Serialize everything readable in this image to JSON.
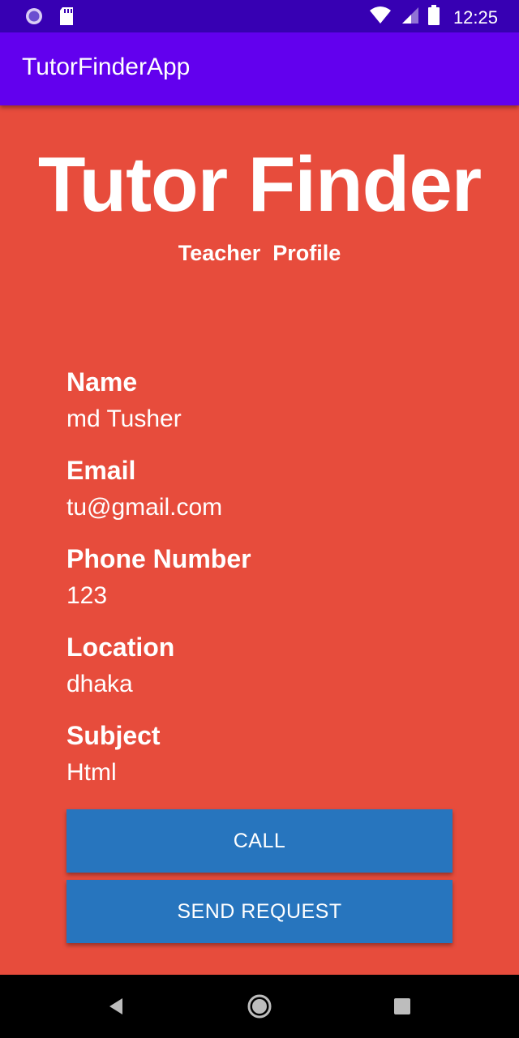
{
  "status_bar": {
    "time": "12:25",
    "icons": [
      "app-notification-icon",
      "sd-card-icon",
      "wifi-icon",
      "signal-icon",
      "battery-icon"
    ]
  },
  "app_bar": {
    "title": "TutorFinderApp"
  },
  "hero": {
    "title": "Tutor Finder",
    "subtitle": "Teacher  Profile"
  },
  "profile": {
    "name_label": "Name",
    "name_value": "md Tusher",
    "email_label": "Email",
    "email_value": "tu@gmail.com",
    "phone_label": "Phone Number",
    "phone_value": "123",
    "location_label": "Location",
    "location_value": "dhaka",
    "subject_label": "Subject",
    "subject_value": "Html"
  },
  "actions": {
    "call_label": "CALL",
    "send_request_label": "SEND REQUEST"
  },
  "nav_bar": {
    "icons": [
      "back-icon",
      "home-icon",
      "recents-icon"
    ]
  },
  "colors": {
    "status_bar": "#3700b3",
    "app_bar": "#6200ee",
    "background": "#e74c3c",
    "button": "#2775be"
  }
}
